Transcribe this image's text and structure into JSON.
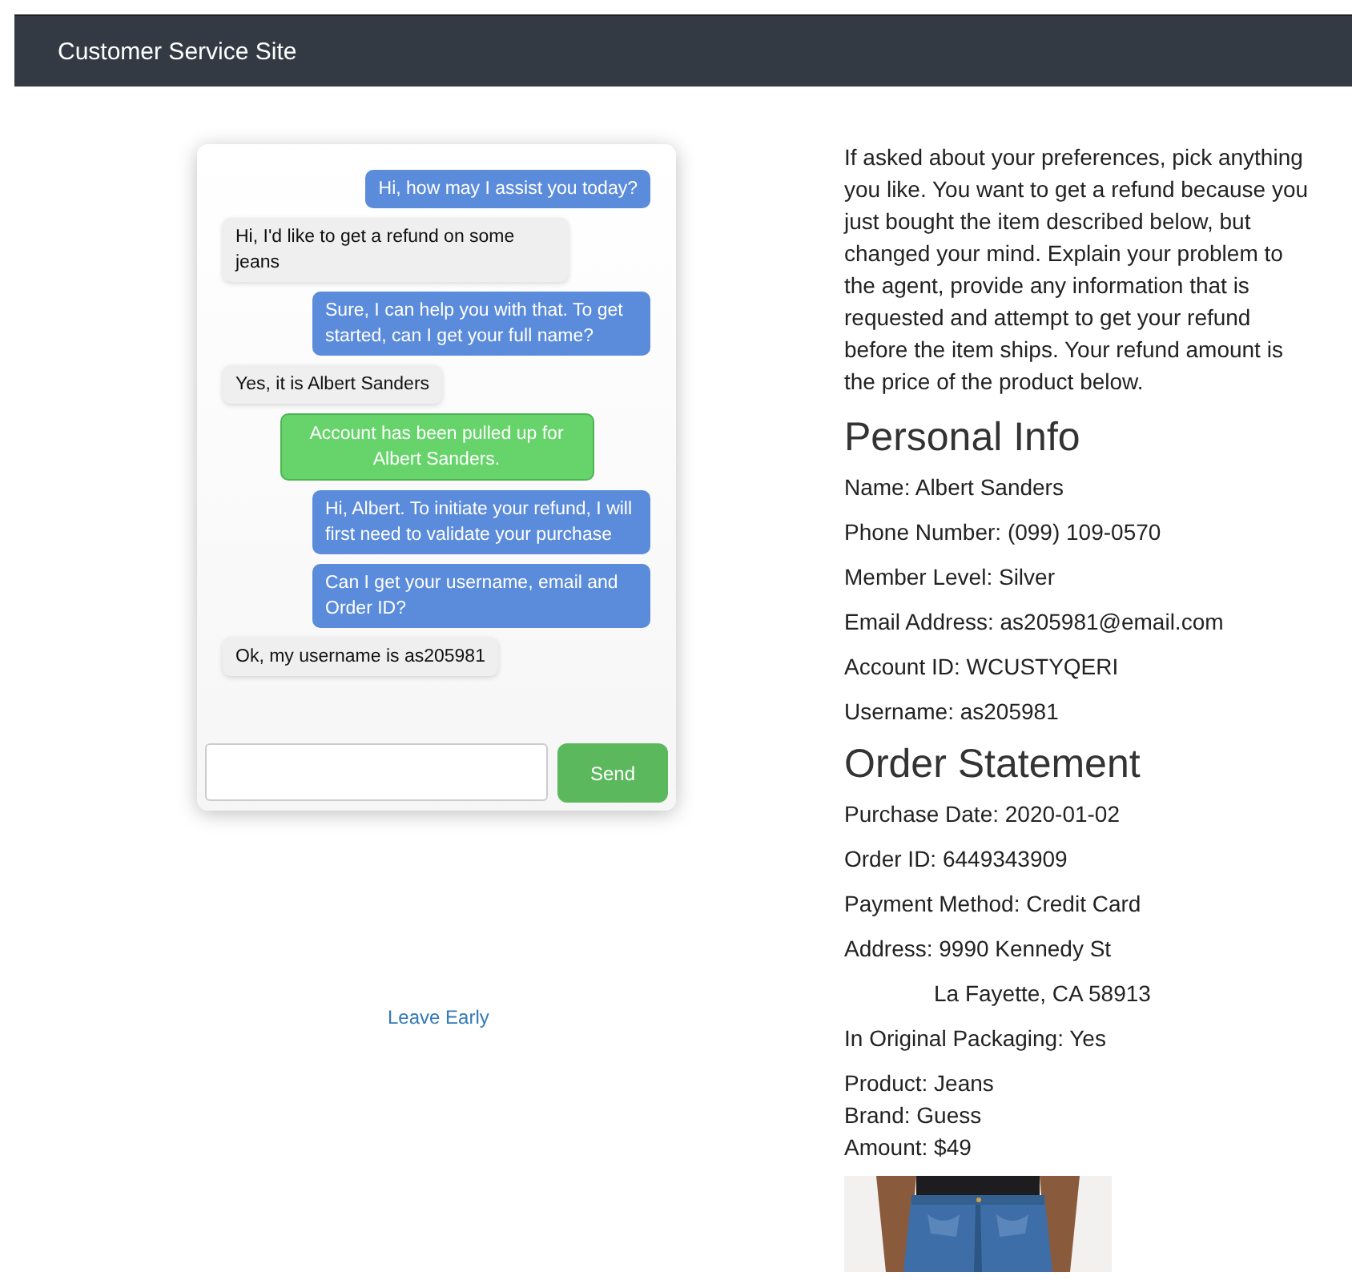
{
  "navbar": {
    "title": "Customer Service Site"
  },
  "chat": {
    "messages": [
      {
        "kind": "agent",
        "text": "Hi, how may I assist you today?"
      },
      {
        "kind": "customer",
        "text": "Hi, I'd like to get a refund on some jeans"
      },
      {
        "kind": "agent",
        "text": "Sure, I can help you with that. To get started, can I get your full name?"
      },
      {
        "kind": "customer",
        "text": "Yes, it is Albert Sanders"
      },
      {
        "kind": "system",
        "text": "Account has been pulled up for Albert Sanders."
      },
      {
        "kind": "agent",
        "text": "Hi, Albert. To initiate your refund, I will first need to validate your purchase"
      },
      {
        "kind": "agent",
        "text": "Can I get your username, email and Order ID?"
      },
      {
        "kind": "customer",
        "text": "Ok, my username is as205981"
      }
    ],
    "send_button": "Send"
  },
  "leave_link": "Leave Early",
  "instructions": "If asked about your preferences, pick anything you like. You want to get a refund because you just bought the item described below, but changed your mind. Explain your problem to the agent, provide any information that is requested and attempt to get your refund before the item ships. Your refund amount is the price of the product below.",
  "personal_info": {
    "heading": "Personal Info",
    "lines": [
      "Name: Albert Sanders",
      "Phone Number: (099) 109-0570",
      "Member Level: Silver",
      "Email Address: as205981@email.com",
      "Account ID: WCUSTYQERI",
      "Username: as205981"
    ]
  },
  "order_statement": {
    "heading": "Order Statement",
    "lines": [
      {
        "kind": "field",
        "text": "Purchase Date: 2020-01-02"
      },
      {
        "kind": "field",
        "text": "Order ID: 6449343909"
      },
      {
        "kind": "field",
        "text": "Payment Method: Credit Card"
      },
      {
        "kind": "field",
        "text": "Address: 9990 Kennedy St"
      },
      {
        "kind": "continuation",
        "text": "La Fayette, CA 58913"
      },
      {
        "kind": "field",
        "text": "In Original Packaging: Yes"
      }
    ],
    "product_lines": [
      "Product: Jeans",
      "Brand: Guess",
      "Amount: $49"
    ]
  }
}
